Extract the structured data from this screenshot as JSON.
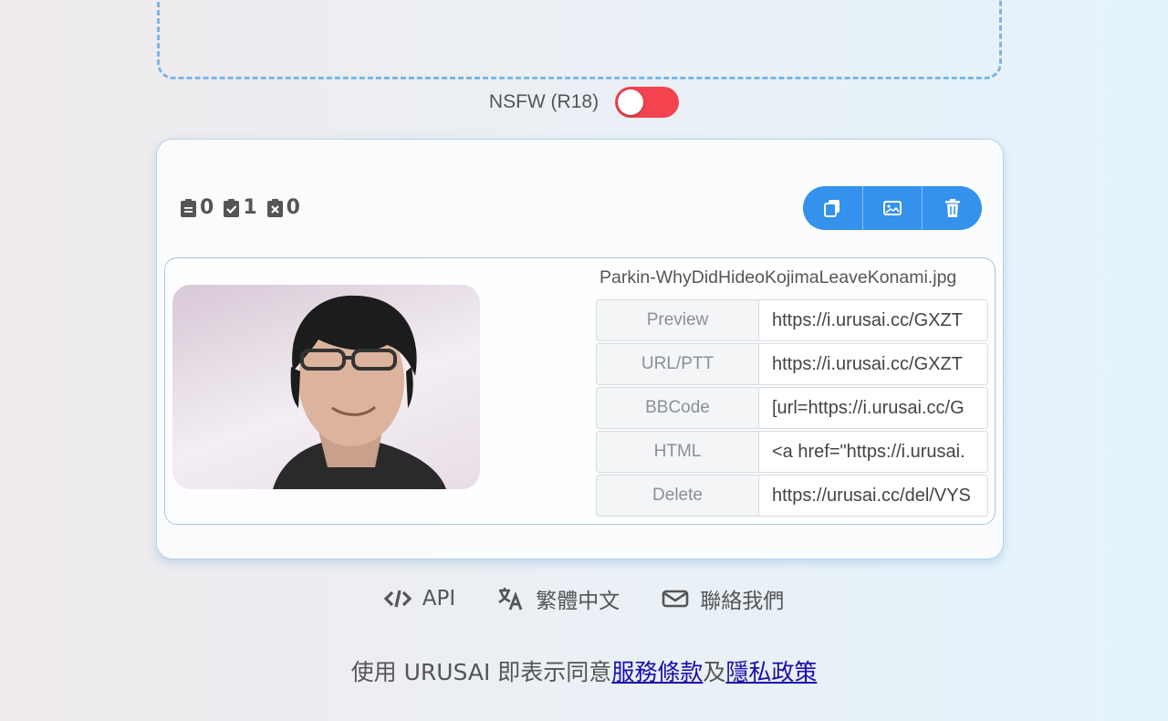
{
  "nsfw": {
    "label": "NSFW (R18)",
    "enabled": false,
    "toggle_color": "#f2434f"
  },
  "stats": {
    "pending": "0",
    "done": "1",
    "failed": "0"
  },
  "actions": [
    "copy-icon",
    "image-icon",
    "trash-icon"
  ],
  "accent": "#3491ec",
  "item": {
    "filename": "Parkin-WhyDidHideoKojimaLeaveKonami.jpg",
    "links": [
      {
        "label": "Preview",
        "value": "https://i.urusai.cc/GXZT"
      },
      {
        "label": "URL/PTT",
        "value": "https://i.urusai.cc/GXZT"
      },
      {
        "label": "BBCode",
        "value": "[url=https://i.urusai.cc/G"
      },
      {
        "label": "HTML",
        "value": "<a href=\"https://i.urusai."
      },
      {
        "label": "Delete",
        "value": "https://urusai.cc/del/VYS"
      }
    ]
  },
  "footer": {
    "api": "API",
    "language": "繁體中文",
    "contact": "聯絡我們"
  },
  "terms": {
    "prefix": "使用 URUSAI 即表示同意",
    "tos": "服務條款",
    "and": "及",
    "privacy": "隱私政策"
  }
}
